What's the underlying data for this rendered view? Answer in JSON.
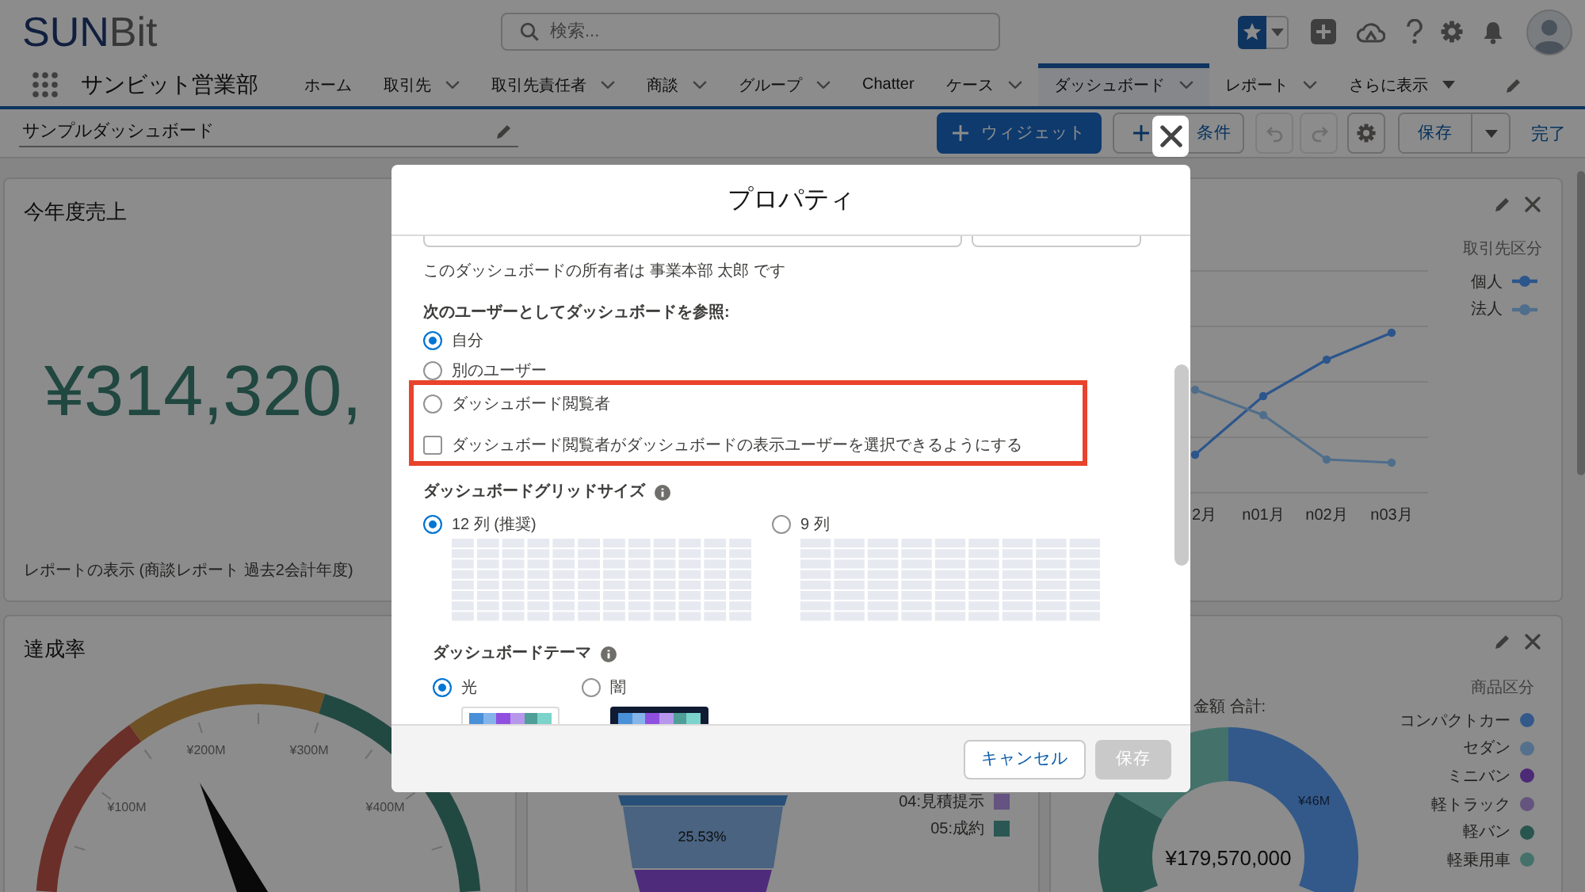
{
  "header": {
    "logo": [
      "SUN",
      "Bit"
    ],
    "search": {
      "placeholder": "検索..."
    }
  },
  "nav": {
    "app_name": "サンビット営業部",
    "tabs": [
      {
        "label": "ホーム",
        "dropdown": false,
        "selected": false
      },
      {
        "label": "取引先",
        "dropdown": true,
        "selected": false
      },
      {
        "label": "取引先責任者",
        "dropdown": true,
        "selected": false
      },
      {
        "label": "商談",
        "dropdown": true,
        "selected": false
      },
      {
        "label": "グループ",
        "dropdown": true,
        "selected": false
      },
      {
        "label": "Chatter",
        "dropdown": false,
        "selected": false
      },
      {
        "label": "ケース",
        "dropdown": true,
        "selected": false
      },
      {
        "label": "ダッシュボード",
        "dropdown": true,
        "selected": true
      },
      {
        "label": "レポート",
        "dropdown": true,
        "selected": false
      }
    ],
    "more": {
      "label": "さらに表示"
    }
  },
  "toolbar": {
    "title": "サンプルダッシュボード",
    "buttons": [
      {
        "kind": "primary",
        "label": "ウィジェット"
      },
      {
        "kind": "neutral",
        "label": "条件"
      }
    ],
    "icon_buttons": [
      {
        "kind": "undo",
        "disabled": true
      },
      {
        "kind": "redo",
        "disabled": true
      },
      {
        "kind": "settings",
        "disabled": false
      }
    ],
    "save": {
      "label": "保存"
    },
    "done": {
      "label": "完了"
    }
  },
  "dashboard": {
    "metric": {
      "title": "今年度売上",
      "value": "¥314,320,",
      "footer": "レポートの表示 (商談レポート 過去2会計年度)"
    },
    "gauge": {
      "title": "達成率",
      "tick_labels": [
        "¥100M",
        "¥200M",
        "¥300M",
        "¥400M"
      ]
    },
    "funnel": {
      "band_label": "25.53%",
      "legend": [
        {
          "label": "04:見積提示",
          "color": "#655382"
        },
        {
          "label": "05:成約",
          "color": "#2b5754"
        }
      ]
    },
    "line_chart": {
      "legend_title": "取引先区分",
      "series": [
        {
          "name": "個人",
          "color": "#2c558c"
        },
        {
          "name": "法人",
          "color": "#4f6e8b"
        }
      ],
      "x_labels": [
        "2月",
        "n01月",
        "n02月",
        "n03月"
      ]
    },
    "donut": {
      "heading": "金額 合計:",
      "total": "¥179,570,000",
      "slice_label": "¥46M",
      "legend_title": "商品区分",
      "legend": [
        {
          "label": "コンパクトカー",
          "color": "#33598a"
        },
        {
          "label": "セダン",
          "color": "#56708c"
        },
        {
          "label": "ミニバン",
          "color": "#4c2b76"
        },
        {
          "label": "軽トラック",
          "color": "#65557e"
        },
        {
          "label": "軽バン",
          "color": "#29554f"
        },
        {
          "label": "軽乗用車",
          "color": "#45726b"
        }
      ]
    }
  },
  "modal": {
    "title": "プロパティ",
    "owner_text": "このダッシュボードの所有者は 事業本部 太郎 です",
    "view_as": {
      "label": "次のユーザーとしてダッシュボードを参照:",
      "options": [
        {
          "label": "自分",
          "selected": true,
          "highlighted": false
        },
        {
          "label": "別のユーザー",
          "selected": false,
          "highlighted": false
        },
        {
          "label": "ダッシュボード閲覧者",
          "selected": false,
          "highlighted": true
        }
      ],
      "allow_choice": {
        "label": "ダッシュボード閲覧者がダッシュボードの表示ユーザーを選択できるようにする",
        "checked": false,
        "highlighted": true
      }
    },
    "grid_size": {
      "label": "ダッシュボードグリッドサイズ",
      "options": [
        {
          "label": "12 列 (推奨)",
          "selected": true,
          "kind": "grid12"
        },
        {
          "label": "9 列",
          "selected": false,
          "kind": "grid9"
        }
      ]
    },
    "theme": {
      "label": "ダッシュボードテーマ",
      "options": [
        {
          "label": "光",
          "selected": true,
          "kind": "light"
        },
        {
          "label": "闇",
          "selected": false,
          "kind": "dark"
        }
      ]
    },
    "footer_buttons": [
      {
        "label": "キャンセル",
        "kind": "neutral",
        "disabled": false
      },
      {
        "label": "保存",
        "kind": "primary",
        "disabled": true
      }
    ]
  }
}
